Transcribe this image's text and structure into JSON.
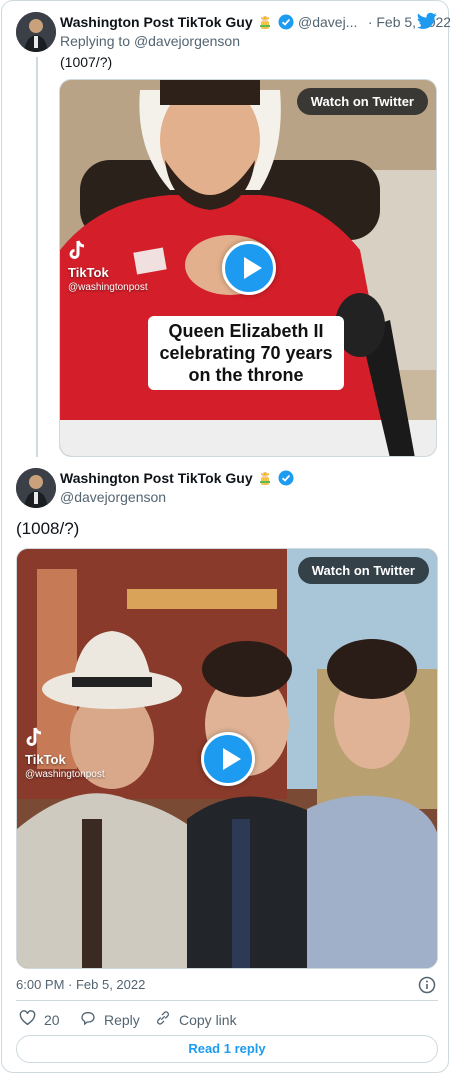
{
  "tweet1": {
    "author_name": "Washington Post TikTok Guy",
    "handle": "@davej...",
    "date": "· Feb 5, 2022",
    "replying_prefix": "Replying to ",
    "replying_to": "@davejorgenson",
    "text": "(1007/?)",
    "media": {
      "watch_label": "Watch on Twitter",
      "tiktok_label": "TikTok",
      "tiktok_handle": "@washingtonpost",
      "caption_lines": [
        "Queen Elizabeth II",
        "celebrating 70 years",
        "on the throne"
      ]
    }
  },
  "tweet2": {
    "author_name": "Washington Post TikTok Guy",
    "handle": "@davejorgenson",
    "text": "(1008/?)",
    "media": {
      "watch_label": "Watch on Twitter",
      "tiktok_label": "TikTok",
      "tiktok_handle": "@washingtonpost"
    },
    "timestamp": "6:00 PM · Feb 5, 2022",
    "like_count": "20",
    "reply_label": "Reply",
    "copy_link_label": "Copy link",
    "read_replies_label": "Read 1 reply"
  },
  "icons": {
    "twitter_logo": "twitter-bird-icon",
    "verified": "verified-badge-icon",
    "info": "info-icon",
    "like": "heart-icon",
    "reply": "reply-bubble-icon",
    "copy_link": "link-icon"
  },
  "colors": {
    "accent": "#1d9bf0",
    "muted": "#536471",
    "border": "#cfd9de"
  }
}
